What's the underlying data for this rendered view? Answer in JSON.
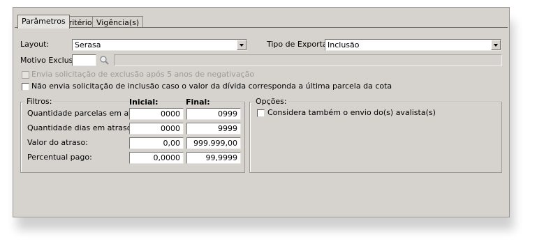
{
  "tabs": [
    {
      "label": "Parâmetros",
      "active": true
    },
    {
      "label": "Critérios",
      "active": false
    },
    {
      "label": "Vigência(s)",
      "active": false
    }
  ],
  "layout": {
    "label": "Layout:",
    "value": "Serasa"
  },
  "export_type": {
    "label": "Tipo de Exportação:",
    "value": "Inclusão"
  },
  "exclusion_reason": {
    "label": "Motivo Exclusão:",
    "code": "",
    "description": "",
    "search_icon": "magnifier-icon"
  },
  "options": {
    "exclusion_after_5_years": {
      "label": "Envia solicitação de exclusão após 5 anos de negativação",
      "checked": false,
      "enabled": false
    },
    "no_inclusion_last_installment": {
      "label": "Não envia solicitação de inclusão caso o valor da dívida corresponda a última parcela da cota",
      "checked": false,
      "enabled": true
    }
  },
  "filters": {
    "title": "Filtros:",
    "col_initial": "Inicial:",
    "col_final": "Final:",
    "rows": [
      {
        "label": "Quantidade parcelas em atraso:",
        "initial": "0000",
        "final": "0999"
      },
      {
        "label": "Quantidade dias em atraso:",
        "initial": "0000",
        "final": "9999"
      },
      {
        "label": "Valor do atraso:",
        "initial": "0,00",
        "final": "999.999,00"
      },
      {
        "label": "Percentual pago:",
        "initial": "0,0000",
        "final": "99,9999"
      }
    ]
  },
  "opcoes": {
    "title": "Opções:",
    "consider_guarantor": {
      "label": "Considera também o envio do(s) avalista(s)",
      "checked": false
    }
  }
}
